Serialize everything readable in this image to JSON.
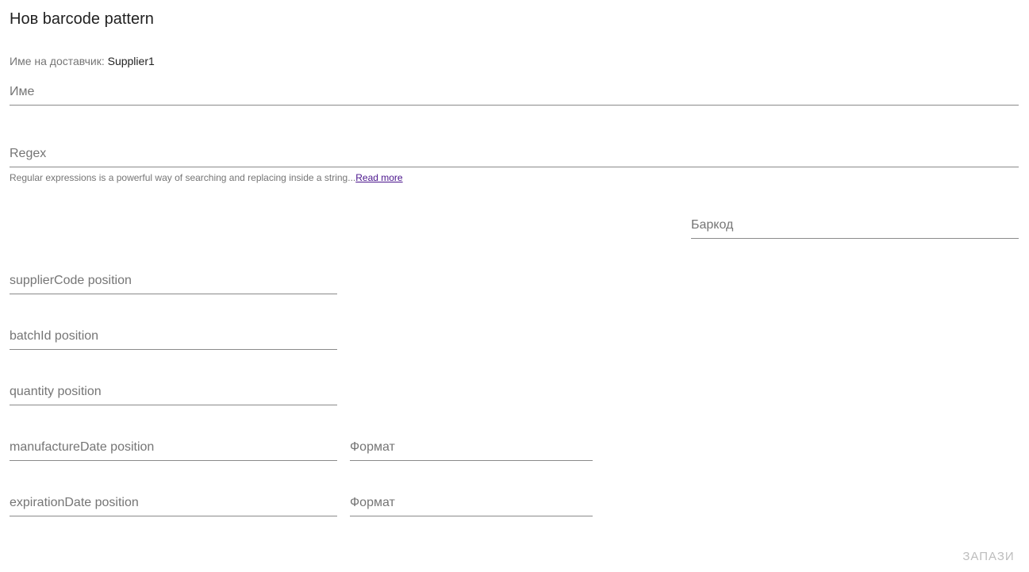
{
  "header": {
    "title": "Нов barcode pattern"
  },
  "supplier": {
    "label": "Име на доставчик:",
    "value": "Supplier1"
  },
  "form": {
    "name_placeholder": "Име",
    "regex_placeholder": "Regex",
    "regex_hint": "Regular expressions is a powerful way of searching and replacing inside a string...",
    "regex_hint_link": "Read more",
    "barcode_placeholder": "Баркод",
    "supplier_code_placeholder": "supplierCode position",
    "batch_id_placeholder": "batchId position",
    "quantity_placeholder": "quantity position",
    "manufacture_date_placeholder": "manufactureDate position",
    "manufacture_format_placeholder": "Формат",
    "expiration_date_placeholder": "expirationDate position",
    "expiration_format_placeholder": "Формат"
  },
  "actions": {
    "save_label": "ЗАПАЗИ"
  }
}
